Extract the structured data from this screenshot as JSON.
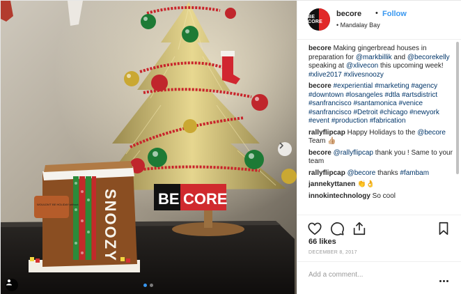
{
  "post": {
    "username": "becore",
    "separator": "•",
    "follow_label": "Follow",
    "location": "Mandalay Bay",
    "avatar_text": "BE CORE",
    "likes": "66 likes",
    "date": "DECEMBER 8, 2017",
    "comment_placeholder": "Add a comment..."
  },
  "photo": {
    "box_label": "SNOOZY",
    "sign_left": "BE",
    "sign_right": "CORE",
    "note_text": "WOULDN'T BE HOLIDAY without"
  },
  "comments": [
    {
      "user": "becore",
      "parts": [
        {
          "t": "Making gingerbread houses in preparation for ",
          "tag": false
        },
        {
          "t": "@markbillik",
          "tag": true
        },
        {
          "t": " and ",
          "tag": false
        },
        {
          "t": "@becorekelly",
          "tag": true
        },
        {
          "t": " speaking at ",
          "tag": false
        },
        {
          "t": "@xlivecon",
          "tag": true
        },
        {
          "t": " this upcoming week! ",
          "tag": false
        },
        {
          "t": "#xlive2017",
          "tag": true
        },
        {
          "t": " ",
          "tag": false
        },
        {
          "t": "#xlivesnoozy",
          "tag": true
        }
      ]
    },
    {
      "user": "becore",
      "parts": [
        {
          "t": "#experiential",
          "tag": true
        },
        {
          "t": " ",
          "tag": false
        },
        {
          "t": "#marketing",
          "tag": true
        },
        {
          "t": " ",
          "tag": false
        },
        {
          "t": "#agency",
          "tag": true
        },
        {
          "t": " ",
          "tag": false
        },
        {
          "t": "#downtown",
          "tag": true
        },
        {
          "t": " ",
          "tag": false
        },
        {
          "t": "#losangeles",
          "tag": true
        },
        {
          "t": " ",
          "tag": false
        },
        {
          "t": "#dtla",
          "tag": true
        },
        {
          "t": " ",
          "tag": false
        },
        {
          "t": "#artsdistrict",
          "tag": true
        },
        {
          "t": " ",
          "tag": false
        },
        {
          "t": "#sanfrancisco",
          "tag": true
        },
        {
          "t": " ",
          "tag": false
        },
        {
          "t": "#santamonica",
          "tag": true
        },
        {
          "t": " ",
          "tag": false
        },
        {
          "t": "#venice",
          "tag": true
        },
        {
          "t": " ",
          "tag": false
        },
        {
          "t": "#sanfrancisco",
          "tag": true
        },
        {
          "t": " ",
          "tag": false
        },
        {
          "t": "#Detroit",
          "tag": true
        },
        {
          "t": " ",
          "tag": false
        },
        {
          "t": "#chicago",
          "tag": true
        },
        {
          "t": " ",
          "tag": false
        },
        {
          "t": "#newyork",
          "tag": true
        },
        {
          "t": " ",
          "tag": false
        },
        {
          "t": "#event",
          "tag": true
        },
        {
          "t": " ",
          "tag": false
        },
        {
          "t": "#production",
          "tag": true
        },
        {
          "t": " ",
          "tag": false
        },
        {
          "t": "#fabrication",
          "tag": true
        }
      ]
    },
    {
      "user": "rallyflipcap",
      "parts": [
        {
          "t": "Happy Holidays to the ",
          "tag": false
        },
        {
          "t": "@becore",
          "tag": true
        },
        {
          "t": " Team 👍🏼",
          "tag": false
        }
      ]
    },
    {
      "user": "becore",
      "parts": [
        {
          "t": "@rallyflipcap",
          "tag": true
        },
        {
          "t": " thank you ! Same to your team",
          "tag": false
        }
      ]
    },
    {
      "user": "rallyflipcap",
      "parts": [
        {
          "t": "@becore",
          "tag": true
        },
        {
          "t": " thanks ",
          "tag": false
        },
        {
          "t": "#fambam",
          "tag": true
        }
      ]
    },
    {
      "user": "jannekyttanen",
      "parts": [
        {
          "t": "👏👌",
          "tag": false
        }
      ]
    },
    {
      "user": "innokintechnology",
      "parts": [
        {
          "t": "So cool",
          "tag": false
        }
      ]
    }
  ],
  "icons": {
    "like": "heart-icon",
    "comment": "comment-bubble-icon",
    "share": "share-icon",
    "save": "bookmark-icon",
    "more": "more-options-icon",
    "next": "chevron-right-icon",
    "tag": "user-tag-icon"
  },
  "carousel": {
    "slides": 2,
    "current": 1
  },
  "colors": {
    "link": "#003569",
    "follow": "#3897f0",
    "brand_red": "#e12828"
  }
}
